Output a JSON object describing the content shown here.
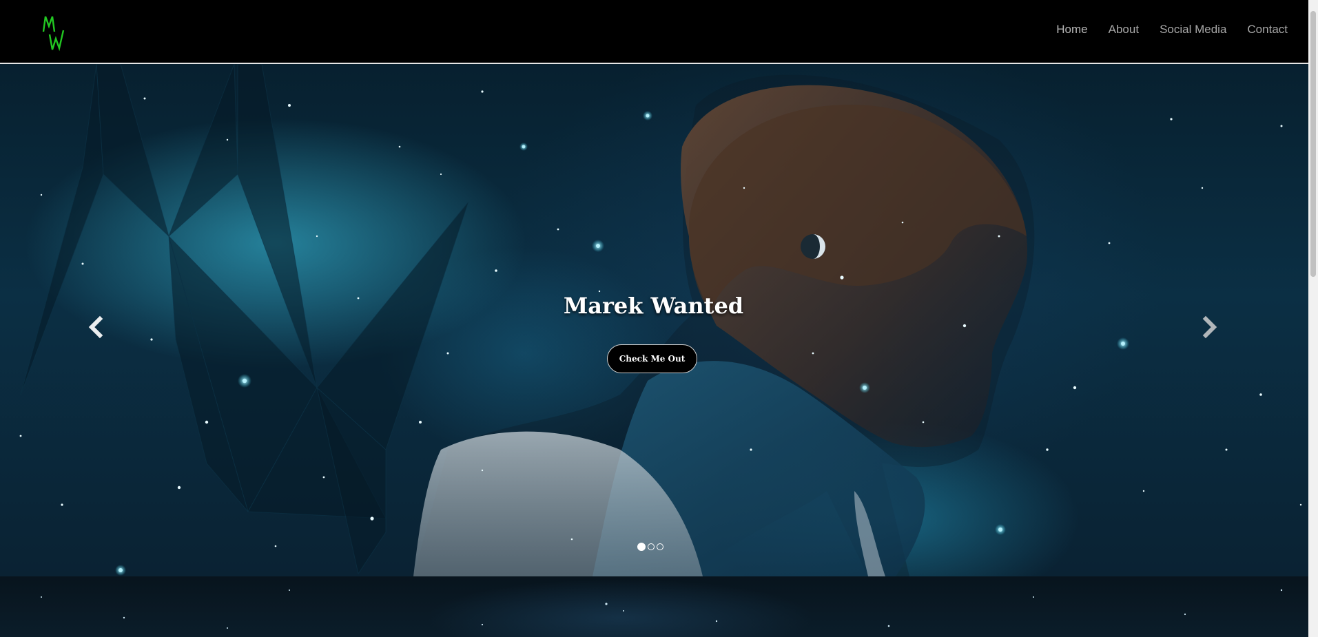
{
  "nav": {
    "logo_alt": "MW",
    "links": [
      {
        "label": "Home"
      },
      {
        "label": "About"
      },
      {
        "label": "Social Media"
      },
      {
        "label": "Contact"
      }
    ]
  },
  "hero": {
    "title": "Marek Wanted",
    "button_label": "Check Me Out",
    "slide_count": 3,
    "active_slide": 1
  },
  "colors": {
    "logo_green": "#22c822",
    "nav_background": "#000000",
    "nav_text": "#a8a8a8",
    "hero_accent": "#3fd0e8"
  },
  "icons": {
    "prev": "chevron-left-icon",
    "next": "chevron-right-icon"
  }
}
